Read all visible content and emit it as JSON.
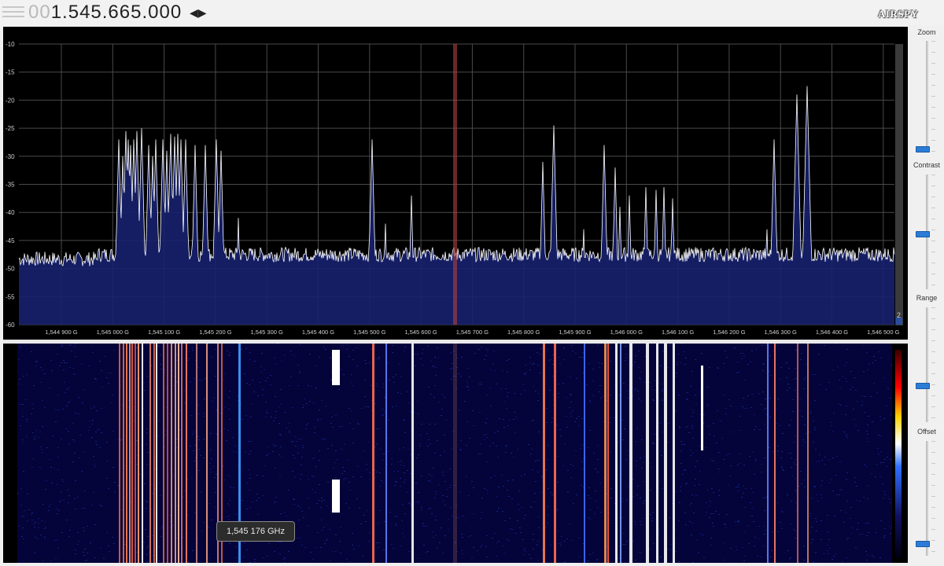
{
  "frequency": {
    "lead": "00",
    "main": "1.545.665.000"
  },
  "logo": "AIRSPY",
  "spectrum": {
    "ylabels": [
      "-10",
      "-15",
      "-20",
      "-25",
      "-30",
      "-35",
      "-40",
      "-45",
      "-50",
      "-55",
      "-60"
    ],
    "xlabels": [
      "1,544 900 G",
      "1,545 000 G",
      "1,545 100 G",
      "1,545 200 G",
      "1,545 300 G",
      "1,545 400 G",
      "1,545 500 G",
      "1,545 600 G",
      "1,545 700 G",
      "1,545 800 G",
      "1,545 900 G",
      "1,546 000 G",
      "1,546 100 G",
      "1,546 200 G",
      "1,546 300 G",
      "1,546 400 G",
      "1,546 500 G"
    ],
    "scroll_value": "2"
  },
  "tooltip": "1,545 176 GHz",
  "controls": {
    "zoom": "Zoom",
    "contrast": "Contrast",
    "range": "Range",
    "offset": "Offset"
  },
  "colors": {
    "grid": "#4a4a4a",
    "trace": "#ffffff",
    "fill": "#17216e",
    "waterfall_bg": "#04043a",
    "tuned_marker": "#c04040",
    "slider_thumb": "#2c7cd6"
  }
}
